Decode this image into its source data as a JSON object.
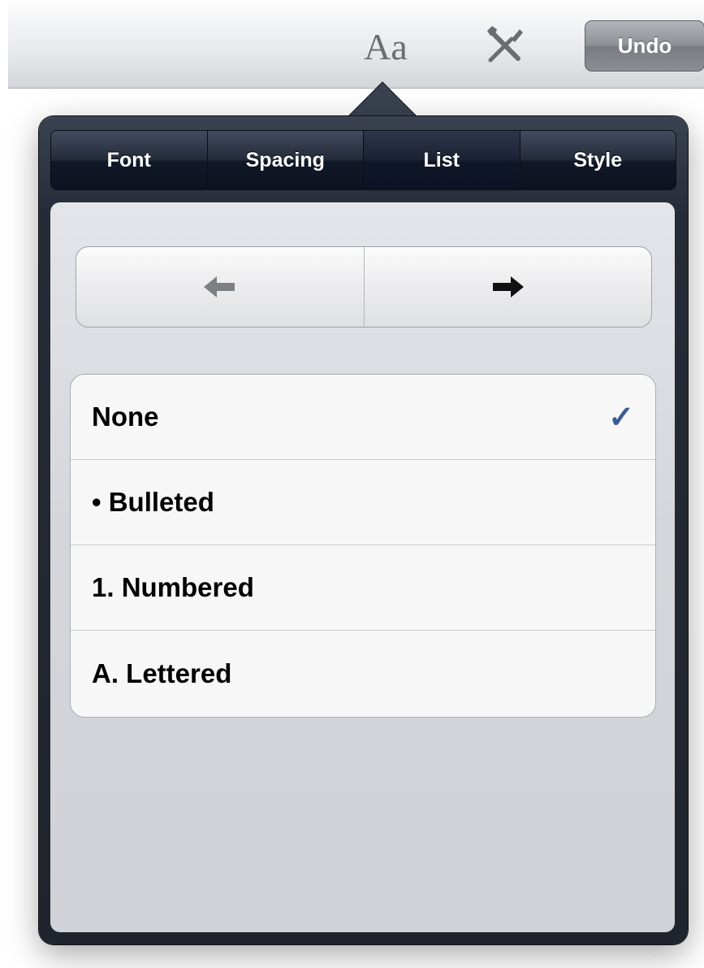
{
  "toolbar": {
    "format_label": "Aa",
    "tools_icon": "wrench-screwdriver-icon",
    "undo_label": "Undo"
  },
  "popover": {
    "tabs": [
      {
        "label": "Font",
        "selected": false
      },
      {
        "label": "Spacing",
        "selected": false
      },
      {
        "label": "List",
        "selected": true
      },
      {
        "label": "Style",
        "selected": false
      }
    ],
    "indent": {
      "decrease_icon": "arrow-left-icon",
      "increase_icon": "arrow-right-icon",
      "decrease_enabled": false,
      "increase_enabled": true
    },
    "list_options": [
      {
        "label": "None",
        "checked": true
      },
      {
        "label": "• Bulleted",
        "checked": false
      },
      {
        "label": "1. Numbered",
        "checked": false
      },
      {
        "label": "A. Lettered",
        "checked": false
      }
    ],
    "check_glyph": "✓"
  },
  "colors": {
    "checkmark": "#3c5a95",
    "popover_frame": "#262c37"
  }
}
